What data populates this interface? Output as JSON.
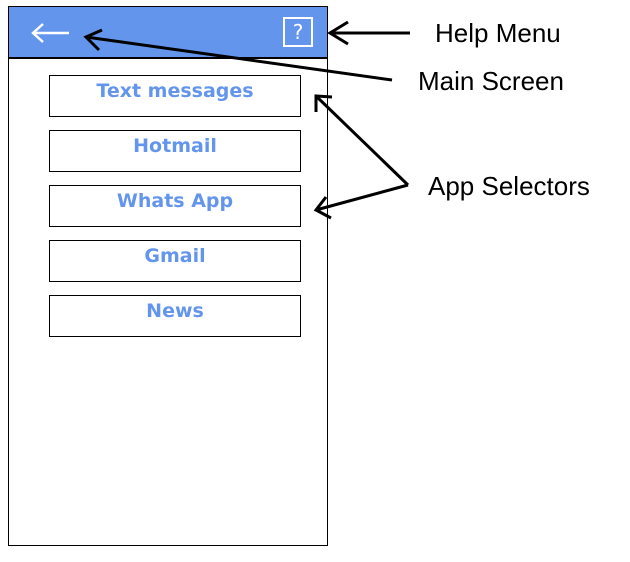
{
  "header": {
    "back_icon": "back-arrow-icon",
    "help_label": "?",
    "background_color": "#6495ED"
  },
  "apps": [
    {
      "label": "Text messages"
    },
    {
      "label": "Hotmail"
    },
    {
      "label": "Whats App"
    },
    {
      "label": "Gmail"
    },
    {
      "label": "News"
    }
  ],
  "annotations": {
    "help_menu": "Help Menu",
    "main_screen": "Main Screen",
    "app_selectors": "App Selectors"
  },
  "colors": {
    "accent": "#6495ED",
    "border": "#000000"
  }
}
